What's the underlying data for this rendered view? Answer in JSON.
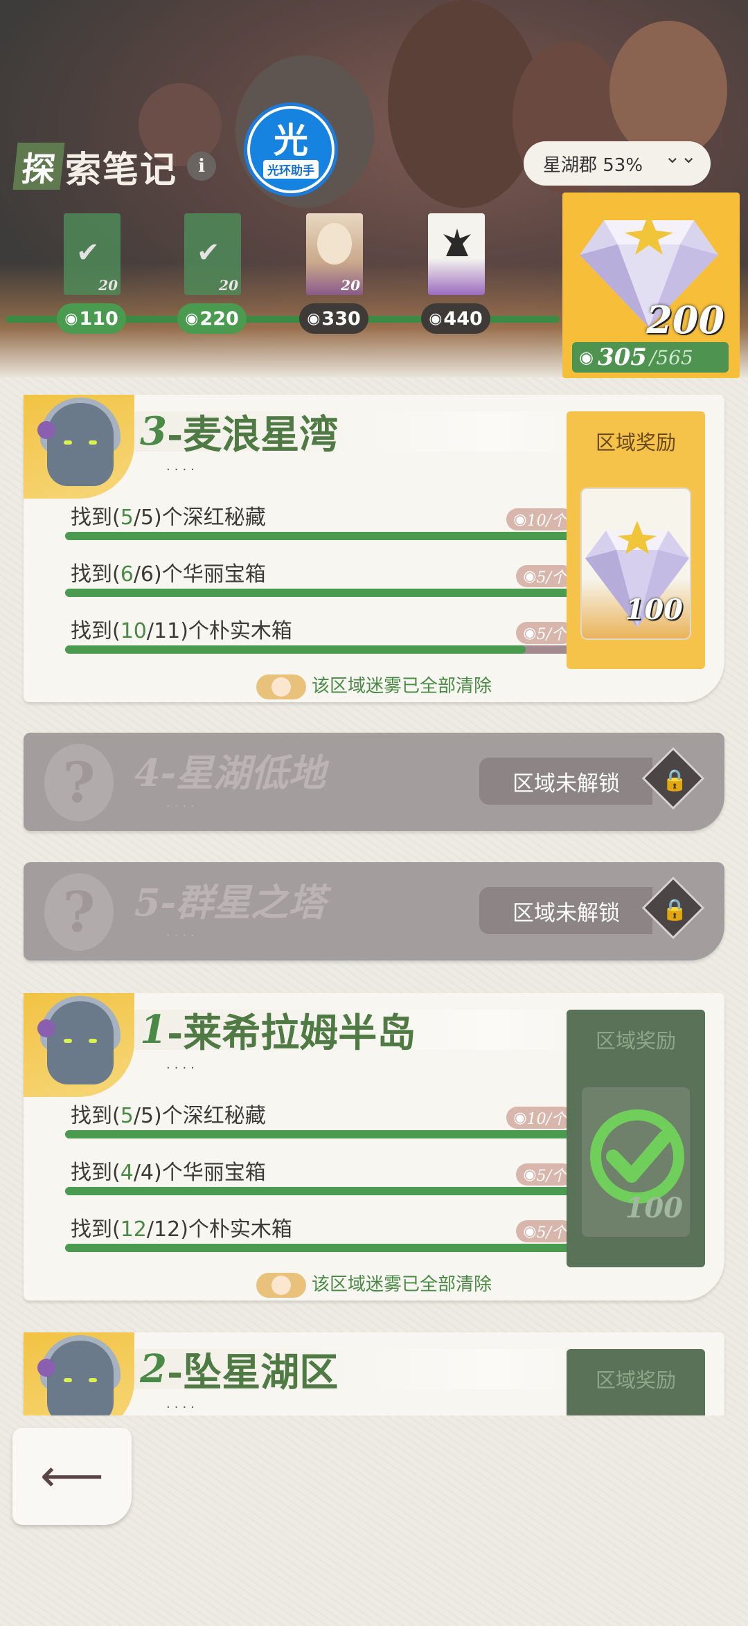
{
  "header": {
    "title_first": "探",
    "title_rest": "索笔记",
    "info_label": "i",
    "logo_char": "光",
    "logo_text": "光环助手",
    "region": "星湖郡 53%",
    "region_chevron": "⌄⌄"
  },
  "milestones": [
    {
      "value": "110",
      "count": "20",
      "completed": true
    },
    {
      "value": "220",
      "count": "20",
      "completed": true
    },
    {
      "value": "330",
      "count": "20",
      "completed": false
    },
    {
      "value": "440",
      "count": "",
      "completed": false
    }
  ],
  "big_reward": {
    "amount": "200",
    "current": "305",
    "total": "/565"
  },
  "cards": [
    {
      "number": "3",
      "name": "-麦浪星湾",
      "dots": "····",
      "tasks": [
        {
          "prefix": "找到(",
          "found": "5",
          "total": "/5)",
          "suffix": "个深红秘藏",
          "reward": "10/个",
          "progress": 1.0
        },
        {
          "prefix": "找到(",
          "found": "6",
          "total": "/6)",
          "suffix": "个华丽宝箱",
          "reward": "5/个",
          "progress": 1.0
        },
        {
          "prefix": "找到(",
          "found": "10",
          "total": "/11)",
          "suffix": "个朴实木箱",
          "reward": "5/个",
          "progress": 0.909
        }
      ],
      "clear_text": "该区域迷雾已全部清除",
      "reward_title": "区域奖励",
      "reward_amount": "100"
    },
    {
      "number": "1",
      "name": "-莱希拉姆半岛",
      "dots": "····",
      "tasks": [
        {
          "prefix": "找到(",
          "found": "5",
          "total": "/5)",
          "suffix": "个深红秘藏",
          "reward": "10/个",
          "progress": 1.0
        },
        {
          "prefix": "找到(",
          "found": "4",
          "total": "/4)",
          "suffix": "个华丽宝箱",
          "reward": "5/个",
          "progress": 1.0
        },
        {
          "prefix": "找到(",
          "found": "12",
          "total": "/12)",
          "suffix": "个朴实木箱",
          "reward": "5/个",
          "progress": 1.0
        }
      ],
      "clear_text": "该区域迷雾已全部清除",
      "reward_title": "区域奖励",
      "reward_amount": "100"
    },
    {
      "number": "2",
      "name": "-坠星湖区",
      "dots": "····",
      "reward_title": "区域奖励"
    }
  ],
  "locked": [
    {
      "title": "4-星湖低地",
      "dots": "····",
      "status": "区域未解锁",
      "q": "?"
    },
    {
      "title": "5-群星之塔",
      "dots": "····",
      "status": "区域未解锁",
      "q": "?"
    }
  ],
  "back_label": "⟵",
  "colors": {
    "accent_green": "#4a9a50",
    "gold": "#f7be3a",
    "locked_gray": "#a49d9d"
  }
}
